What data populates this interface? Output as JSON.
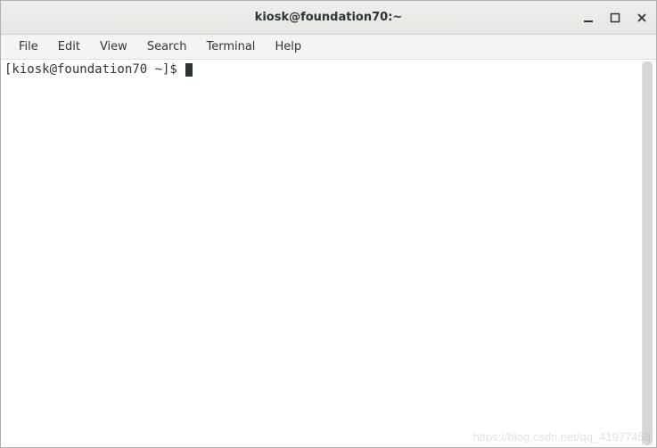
{
  "window": {
    "title": "kiosk@foundation70:~"
  },
  "menubar": {
    "items": [
      {
        "label": "File"
      },
      {
        "label": "Edit"
      },
      {
        "label": "View"
      },
      {
        "label": "Search"
      },
      {
        "label": "Terminal"
      },
      {
        "label": "Help"
      }
    ]
  },
  "terminal": {
    "prompt": "[kiosk@foundation70 ~]$ "
  },
  "watermark": "https://blog.csdn.net/qq_41977453"
}
